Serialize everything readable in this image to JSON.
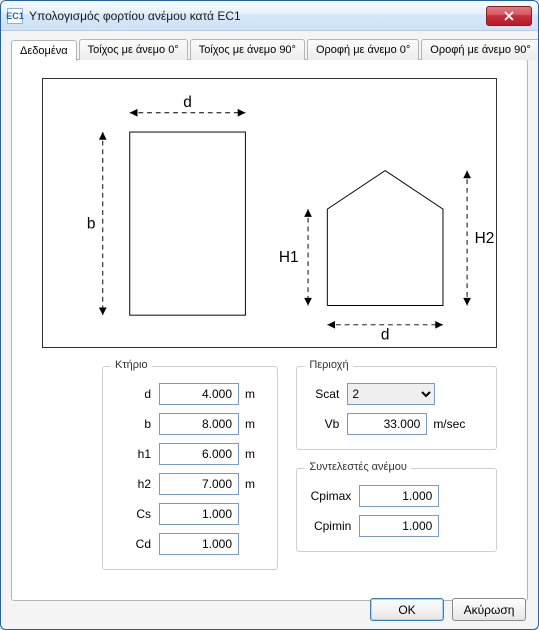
{
  "window": {
    "app_icon_text": "EC1",
    "title": "Υπολογισμός φορτίου ανέμου κατά EC1"
  },
  "tabs": [
    {
      "label": "Δεδομένα",
      "active": true
    },
    {
      "label": "Τοίχος με άνεμο 0°"
    },
    {
      "label": "Τοίχος με άνεμο 90°"
    },
    {
      "label": "Οροφή με άνεμο 0°"
    },
    {
      "label": "Οροφή με άνεμο 90°"
    }
  ],
  "diagram": {
    "labels": {
      "d": "d",
      "b": "b",
      "H1": "H1",
      "H2": "H2"
    }
  },
  "groups": {
    "building": {
      "legend": "Κτήριο",
      "fields": {
        "d": {
          "label": "d",
          "value": "4.000",
          "unit": "m"
        },
        "b": {
          "label": "b",
          "value": "8.000",
          "unit": "m"
        },
        "h1": {
          "label": "h1",
          "value": "6.000",
          "unit": "m"
        },
        "h2": {
          "label": "h2",
          "value": "7.000",
          "unit": "m"
        },
        "Cs": {
          "label": "Cs",
          "value": "1.000",
          "unit": ""
        },
        "Cd": {
          "label": "Cd",
          "value": "1.000",
          "unit": ""
        }
      }
    },
    "region": {
      "legend": "Περιοχή",
      "fields": {
        "Scat": {
          "label": "Scat",
          "value": "2"
        },
        "Vb": {
          "label": "Vb",
          "value": "33.000",
          "unit": "m/sec"
        }
      }
    },
    "coef": {
      "legend": "Συντελεστές ανέμου",
      "fields": {
        "Cpimax": {
          "label": "Cpimax",
          "value": "1.000"
        },
        "Cpimin": {
          "label": "Cpimin",
          "value": "1.000"
        }
      }
    }
  },
  "buttons": {
    "ok": "OK",
    "cancel": "Ακύρωση"
  }
}
